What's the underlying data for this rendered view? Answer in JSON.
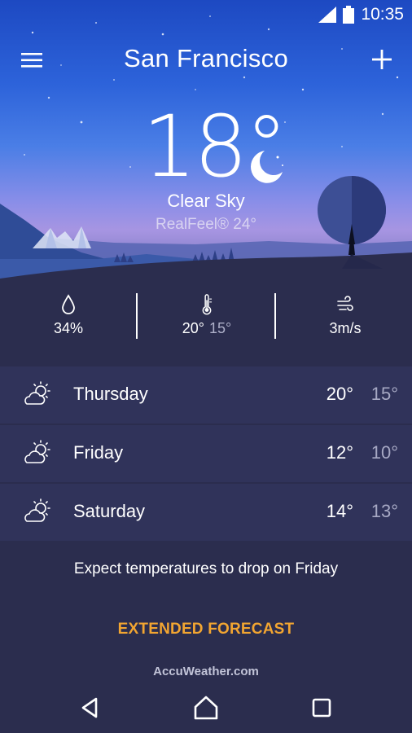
{
  "status_bar": {
    "time": "10:35",
    "icons": [
      "cell-signal-icon",
      "battery-icon"
    ]
  },
  "header": {
    "city": "San Francisco",
    "menu_icon": "menu-icon",
    "add_icon": "plus-icon"
  },
  "current": {
    "temperature": "18°",
    "condition": "Clear Sky",
    "realfeel": "RealFeel® 24°",
    "condition_icon": "moon-icon"
  },
  "stats": {
    "humidity": {
      "icon": "droplet-icon",
      "value": "34%"
    },
    "temperature": {
      "icon": "thermometer-icon",
      "high": "20°",
      "low": "15°"
    },
    "wind": {
      "icon": "wind-icon",
      "value": "3m/s"
    }
  },
  "forecast": [
    {
      "day": "Thursday",
      "hi": "20°",
      "lo": "15°",
      "icon": "partly-cloudy-icon"
    },
    {
      "day": "Friday",
      "hi": "12°",
      "lo": "10°",
      "icon": "partly-cloudy-icon"
    },
    {
      "day": "Saturday",
      "hi": "14°",
      "lo": "13°",
      "icon": "partly-cloudy-icon"
    }
  ],
  "summary": "Expect temperatures to drop on Friday",
  "extended_label": "EXTENDED FORECAST",
  "attribution": "AccuWeather.com",
  "colors": {
    "accent": "#f2a531",
    "background": "#2b2d4e",
    "row": "#30335a",
    "sky_top": "#1d49c2"
  },
  "nav": [
    "back-icon",
    "home-icon",
    "recents-icon"
  ]
}
